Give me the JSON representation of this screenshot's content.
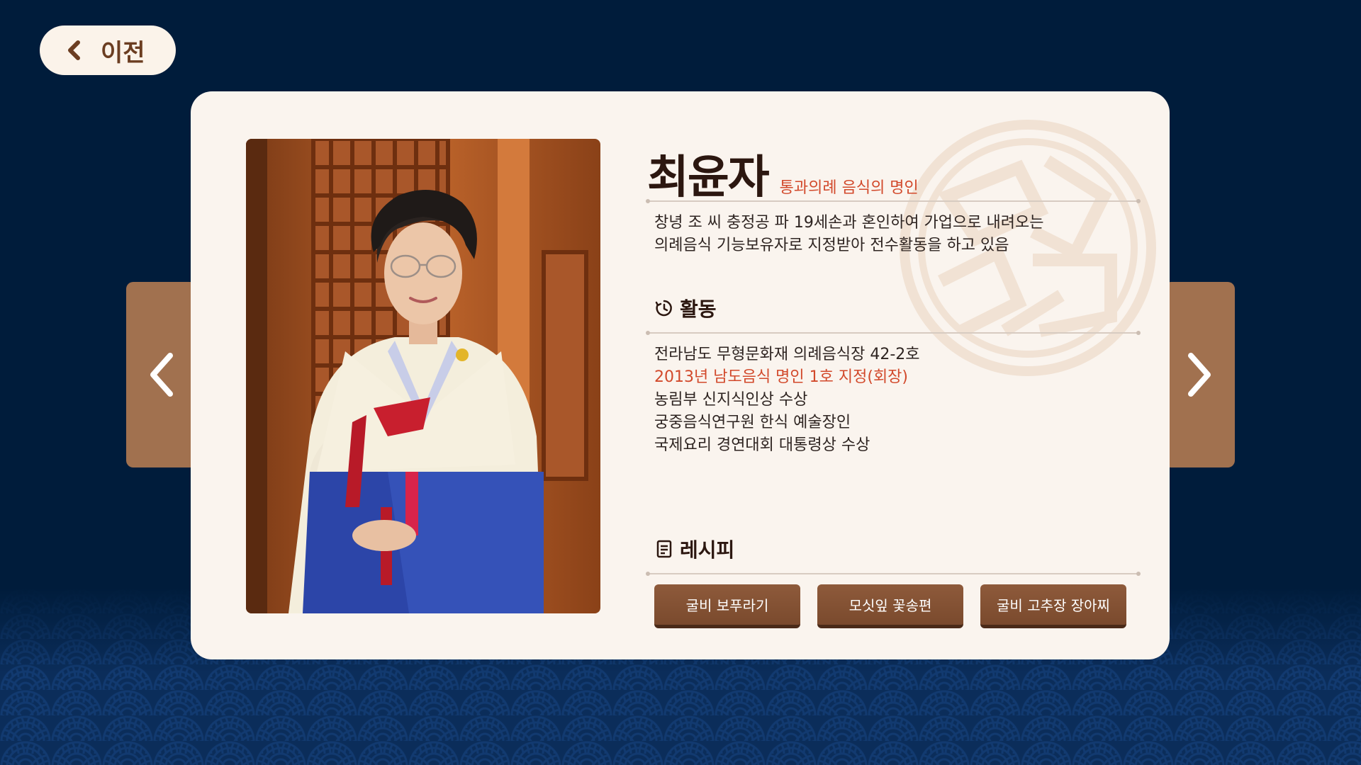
{
  "nav": {
    "back_label": "이전"
  },
  "profile": {
    "name": "최윤자",
    "title": "통과의례 음식의 명인",
    "intro_line1": "창녕 조 씨 충정공 파 19세손과 혼인하여 가업으로 내려오는",
    "intro_line2": "의례음식 기능보유자로 지정받아 전수활동을 하고 있음"
  },
  "activities": {
    "heading": "활동",
    "items": [
      "전라남도 무형문화재 의례음식장 42-2호",
      "2013년 남도음식 명인 1호 지정(회장)",
      "농림부 신지식인상 수상",
      "궁중음식연구원 한식 예술장인",
      "국제요리 경연대회 대통령상 수상"
    ]
  },
  "recipes": {
    "heading": "레시피",
    "buttons": [
      "굴비 보푸라기",
      "모싯잎 꽃송편",
      "굴비 고추장 장아찌"
    ]
  },
  "colors": {
    "background": "#001c3b",
    "card": "#faf4ee",
    "accent_red": "#d2492b",
    "brown_button": "#7a4a2d",
    "side_arrow": "#a1714f"
  },
  "icons": {
    "back": "chevron-left-icon",
    "prev": "chevron-left-icon",
    "next": "chevron-right-icon",
    "activity": "clock-history-icon",
    "recipe": "document-icon"
  }
}
